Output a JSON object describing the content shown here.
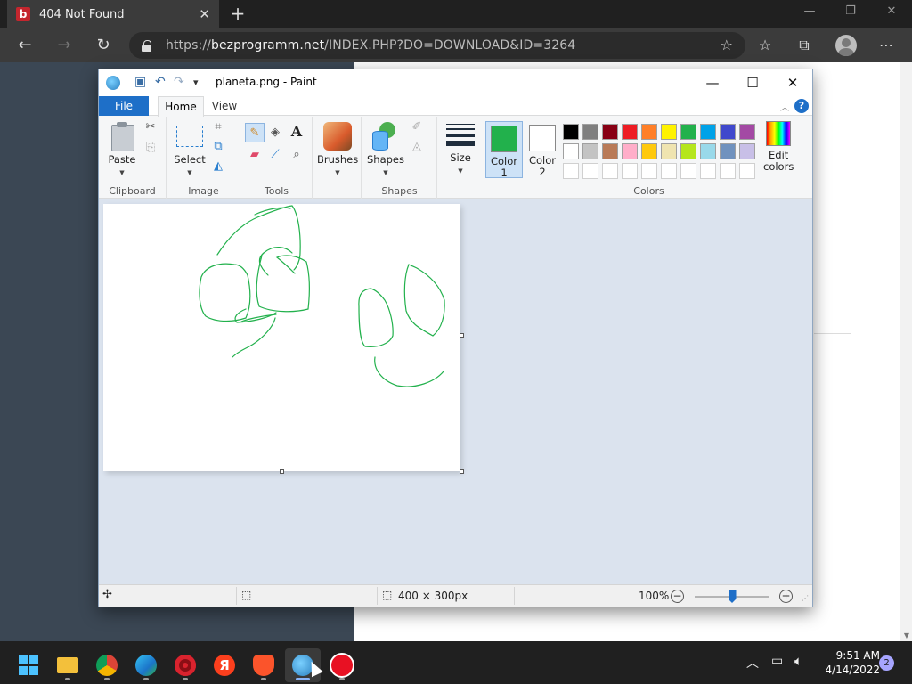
{
  "browser": {
    "tab": {
      "favicon": "b",
      "title": "404 Not Found",
      "close": "✕"
    },
    "new_tab": "+",
    "url_prefix": "https://",
    "url_host": "bezprogramm.net",
    "url_path": "/INDEX.PHP?DO=DOWNLOAD&ID=3264",
    "window_controls": {
      "minimize": "—",
      "restore": "❐",
      "close": "✕"
    },
    "icons": [
      "back-arrow-icon",
      "forward-arrow-icon",
      "refresh-icon",
      "lock-icon",
      "add-favorite-icon",
      "favorites-icon",
      "collections-icon",
      "profile-icon",
      "more-menu-icon"
    ]
  },
  "paint": {
    "title": "planeta.png - Paint",
    "quick_access": {
      "save": "💾",
      "undo": "↶",
      "redo": "↷",
      "customize": "▾"
    },
    "window_controls": {
      "minimize": "—",
      "maximize": "☐",
      "close": "✕"
    },
    "tabs": {
      "file": "File",
      "home": "Home",
      "view": "View"
    },
    "help": "?",
    "collapse": "︿",
    "groups": {
      "clipboard": {
        "label": "Clipboard",
        "paste": "Paste"
      },
      "image": {
        "label": "Image",
        "select": "Select"
      },
      "tools": {
        "label": "Tools"
      },
      "brushes": {
        "label": "Brushes"
      },
      "shapes": {
        "label": "Shapes",
        "shapes": "Shapes"
      },
      "size": {
        "label": "Size"
      },
      "colors": {
        "label": "Colors",
        "color1": "Color\n1",
        "color1_line1": "Color",
        "color1_line2": "1",
        "color2_line1": "Color",
        "color2_line2": "2",
        "edit_line1": "Edit",
        "edit_line2": "colors",
        "color1_value": "#22b14c",
        "color2_value": "#ffffff",
        "palette": [
          "#000000",
          "#7f7f7f",
          "#880015",
          "#ed1c24",
          "#ff7f27",
          "#fff200",
          "#22b14c",
          "#00a2e8",
          "#3f48cc",
          "#a349a4",
          "#ffffff",
          "#c3c3c3",
          "#b97a57",
          "#ffaec9",
          "#ffc90e",
          "#efe4b0",
          "#b5e61d",
          "#99d9ea",
          "#7092be",
          "#c8bfe7",
          "#ffffff",
          "#ffffff",
          "#ffffff",
          "#ffffff",
          "#ffffff",
          "#ffffff",
          "#ffffff",
          "#ffffff",
          "#ffffff",
          "#ffffff"
        ]
      }
    },
    "status": {
      "dimensions": "400 × 300px",
      "zoom": "100%",
      "zoom_level": 0.5
    }
  },
  "taskbar": {
    "apps": [
      "start-icon",
      "file-explorer-icon",
      "chrome-icon",
      "edge-icon",
      "opera-icon",
      "yandex-icon",
      "brave-icon",
      "paint-icon",
      "recorder-icon"
    ],
    "yandex_letter": "Я",
    "time": "9:51 AM",
    "date": "4/14/2022",
    "notifications": "2"
  }
}
